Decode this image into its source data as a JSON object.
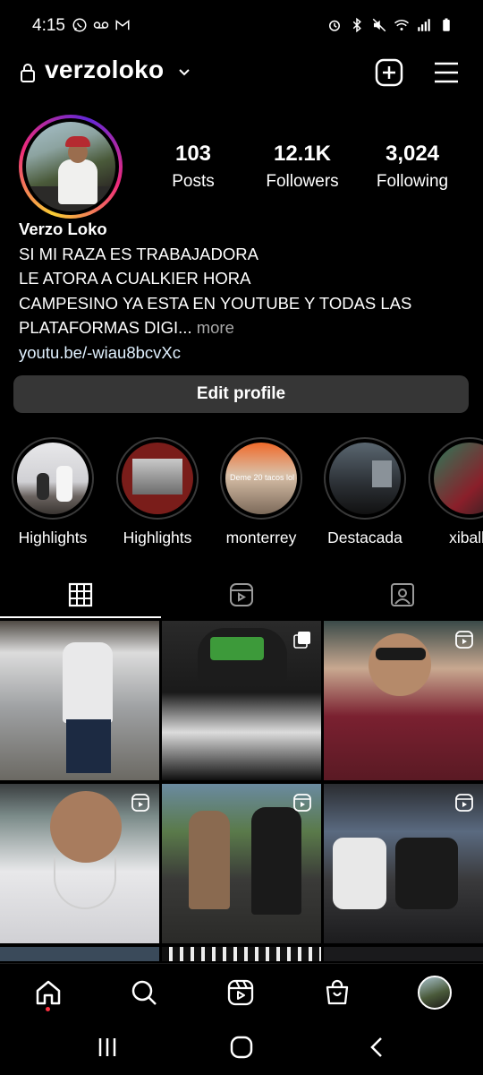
{
  "status_bar": {
    "time": "4:15",
    "left_icons": [
      "whatsapp-icon",
      "voicemail-icon",
      "gmail-icon"
    ],
    "right_icons": [
      "alarm-icon",
      "bluetooth-icon",
      "mute-icon",
      "wifi-icon",
      "signal-icon",
      "battery-icon"
    ]
  },
  "header": {
    "username": "verzoloko",
    "icons": [
      "lock-icon",
      "chevron-down-icon",
      "new-post-icon",
      "menu-icon"
    ]
  },
  "profile": {
    "stats": [
      {
        "value": "103",
        "label": "Posts"
      },
      {
        "value": "12.1K",
        "label": "Followers"
      },
      {
        "value": "3,024",
        "label": "Following"
      }
    ],
    "display_name": "Verzo Loko",
    "bio_lines": [
      "SI MI RAZA ES TRABAJADORA",
      "LE ATORA A CUALKIER HORA",
      "CAMPESINO YA ESTA EN YOUTUBE Y TODAS LAS",
      "PLATAFORMAS DIGI..."
    ],
    "more_label": " more",
    "link": "youtu.be/-wiau8bcvXc",
    "edit_profile_label": "Edit profile"
  },
  "highlights": [
    {
      "label": "Highlights",
      "overlay": ""
    },
    {
      "label": "Highlights",
      "overlay": ""
    },
    {
      "label": "monterrey",
      "overlay": "Deme 20 tacos lol"
    },
    {
      "label": "Destacada",
      "overlay": ""
    },
    {
      "label": "xibalb",
      "overlay": ""
    }
  ],
  "tabs": [
    "grid-icon",
    "reels-icon",
    "tagged-icon"
  ],
  "bottom_nav": [
    "home-icon",
    "search-icon",
    "reels-icon",
    "shop-icon",
    "profile-avatar"
  ],
  "system_nav": [
    "recent-apps-icon",
    "home-button-icon",
    "back-icon"
  ],
  "colors": {
    "background": "#000000",
    "button_bg": "#363636",
    "link": "#e0f1ff",
    "muted": "#a8a8a8",
    "notification_dot": "#ff3040"
  }
}
